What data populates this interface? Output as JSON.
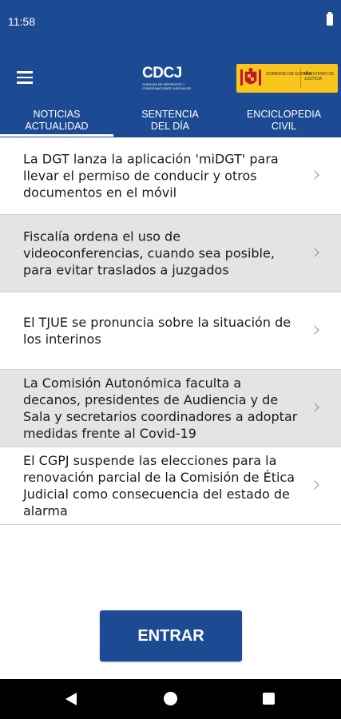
{
  "status_bar": {
    "time": "11:58",
    "battery_icon": "battery-icon"
  },
  "header": {
    "menu_icon": "hamburger-menu-icon",
    "logo": {
      "text": "CDCJ",
      "subtitle": "CUENTAS DE DEPÓSITOS Y CONSIGNACIONES JUDICIALES"
    },
    "government_badge": {
      "left_text": "GOBIERNO DE ESPAÑA",
      "right_text": "MINISTERIO DE JUSTICIA",
      "color": "#f7c51c"
    }
  },
  "tabs": [
    {
      "line1": "NOTICIAS",
      "line2": "ACTUALIDAD",
      "selected": true
    },
    {
      "line1": "SENTENCIA",
      "line2": "DEL DÍA",
      "selected": false
    },
    {
      "line1": "ENCICLOPEDIA",
      "line2": "CIVIL",
      "selected": false
    }
  ],
  "news": [
    {
      "title": "La DGT lanza la aplicación 'miDGT' para llevar el permiso de conducir y otros documentos en el móvil"
    },
    {
      "title": "Fiscalía ordena el uso de videoconferencias, cuando sea posible, para evitar traslados a juzgados"
    },
    {
      "title": "El TJUE se pronuncia sobre la situación de los interinos"
    },
    {
      "title": "La Comisión Autonómica faculta a decanos, presidentes de Audiencia y de Sala y secretarios coordinadores a adoptar medidas frente al Covid-19"
    },
    {
      "title": "El CGPJ suspende las elecciones para la renovación parcial de la Comisión de Ética Judicial como consecuencia del estado de alarma"
    }
  ],
  "enter_button": {
    "label": "ENTRAR"
  },
  "nav_bar": {
    "back_icon": "back-icon",
    "home_icon": "home-icon",
    "recent_icon": "recent-apps-icon"
  },
  "colors": {
    "primary": "#1d4b93",
    "row_alt": "#e4e4e4",
    "text": "#1a1a1a"
  }
}
